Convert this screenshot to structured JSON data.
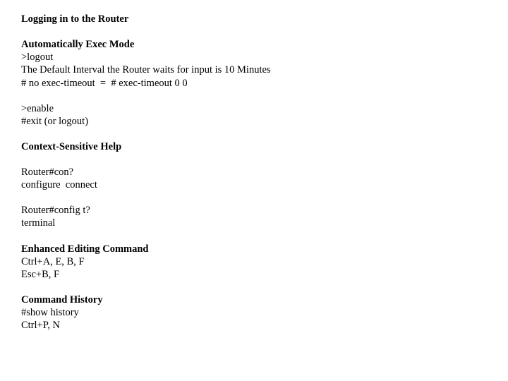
{
  "title": "Logging in to the Router",
  "sec1": {
    "heading": "Automatically Exec Mode",
    "l1": ">logout",
    "l2": "The Default Interval the Router waits for input is 10 Minutes",
    "l3": "# no exec-timeout  =  # exec-timeout 0 0"
  },
  "sec2": {
    "l1": ">enable",
    "l2": "#exit (or logout)"
  },
  "sec3": {
    "heading": "Context-Sensitive Help"
  },
  "sec4": {
    "l1": "Router#con?",
    "l2": "configure  connect"
  },
  "sec5": {
    "l1": "Router#config t?",
    "l2": "terminal"
  },
  "sec6": {
    "heading": "Enhanced Editing Command",
    "l1": "Ctrl+A, E, B, F",
    "l2": "Esc+B, F"
  },
  "sec7": {
    "heading": "Command History",
    "l1": "#show history",
    "l2": "Ctrl+P, N"
  }
}
